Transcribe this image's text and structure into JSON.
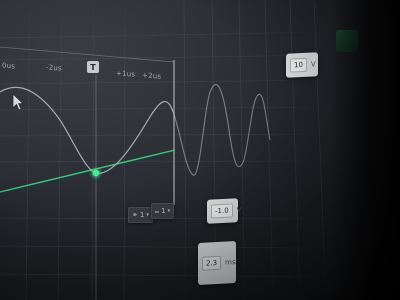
{
  "timeline": {
    "labels": [
      "0us",
      "-2us",
      "+1us",
      "+2us"
    ],
    "trigger_marker": "T"
  },
  "controls": {
    "top_value": {
      "value": "10",
      "unit": "V"
    },
    "offset_value": {
      "value": "-1.0",
      "unit": "V"
    },
    "time_value": {
      "value": "2.3",
      "unit": "ms"
    },
    "channel_button": "1",
    "trigger_button": "1"
  },
  "colors": {
    "waveform": "#9ea2a8",
    "trigger_line": "#2fcf7f",
    "grid": "#4a4e56",
    "background": "#2a2d33"
  }
}
